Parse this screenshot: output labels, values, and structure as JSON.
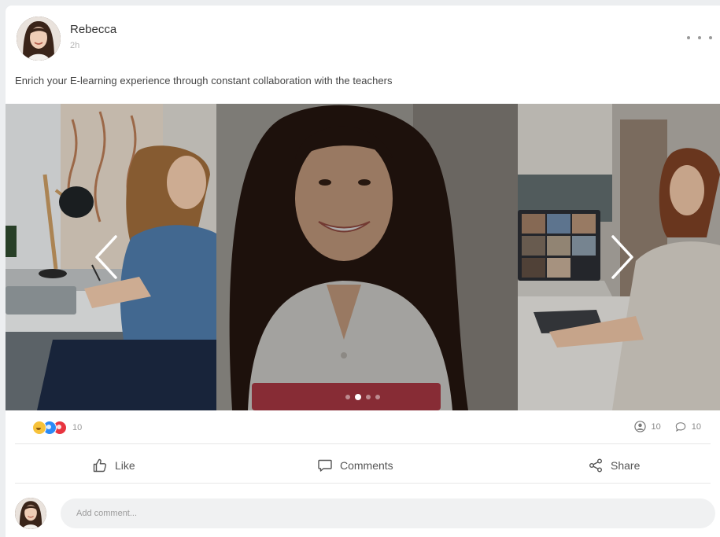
{
  "post": {
    "author": "Rebecca",
    "time": "2h",
    "text": "Enrich your E-learning experience through constant collaboration with the teachers"
  },
  "carousel": {
    "slide_count": 4,
    "active_index": 1
  },
  "stats": {
    "reactions_count": "10",
    "views_count": "10",
    "comments_count": "10"
  },
  "actions": {
    "like": "Like",
    "comments": "Comments",
    "share": "Share"
  },
  "comment_input": {
    "placeholder": "Add comment..."
  },
  "icons": {
    "more": "more-horizontal-icon",
    "prev": "chevron-left-icon",
    "next": "chevron-right-icon",
    "like": "thumbs-up-icon",
    "comments": "chat-bubble-icon",
    "share": "share-icon",
    "views": "user-circle-icon",
    "comment_count": "speech-bubble-icon"
  },
  "colors": {
    "haha": "#f7c23a",
    "like": "#2b8af7",
    "love": "#e8343f"
  }
}
